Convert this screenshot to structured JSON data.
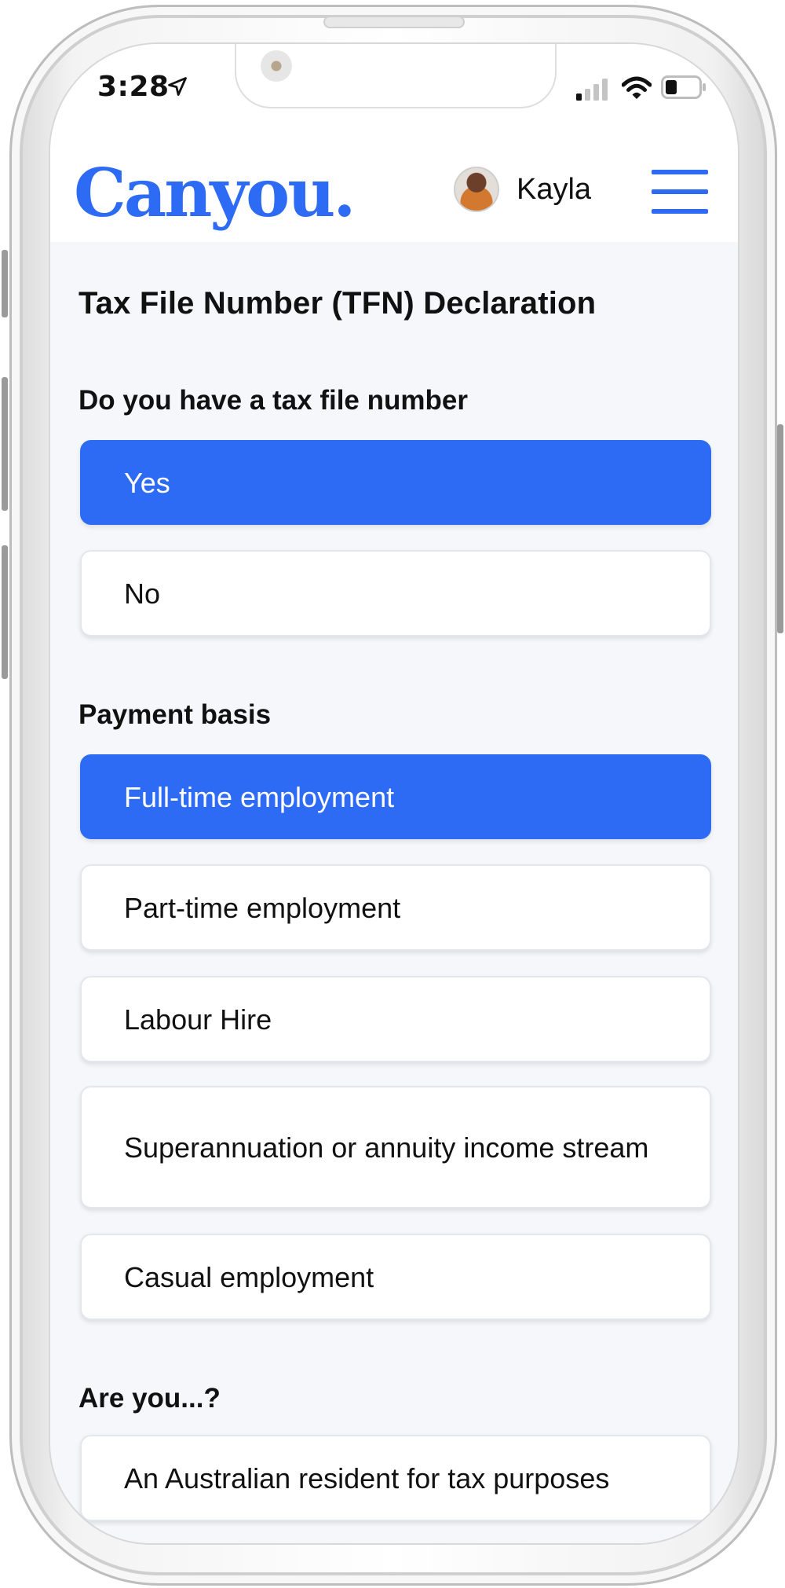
{
  "status_bar": {
    "time": "3:28",
    "icons": [
      "location-arrow-icon",
      "cellular-signal-icon",
      "wifi-icon",
      "battery-icon"
    ]
  },
  "header": {
    "brand": "Canyou.",
    "user_name": "Kayla",
    "menu_icon": "hamburger-menu-icon"
  },
  "form": {
    "title": "Tax File Number (TFN) Declaration",
    "tfn_question": {
      "label": "Do you have a tax file number",
      "options": [
        {
          "label": "Yes",
          "selected": true
        },
        {
          "label": "No",
          "selected": false
        }
      ]
    },
    "payment_basis": {
      "label": "Payment basis",
      "options": [
        {
          "label": "Full-time employment",
          "selected": true
        },
        {
          "label": "Part-time employment",
          "selected": false
        },
        {
          "label": "Labour Hire",
          "selected": false
        },
        {
          "label": "Superannuation or annuity income stream",
          "selected": false
        },
        {
          "label": "Casual employment",
          "selected": false
        }
      ]
    },
    "residency": {
      "label": "Are you...?",
      "options": [
        {
          "label": "An Australian resident for tax purposes",
          "selected": false
        }
      ]
    }
  },
  "colors": {
    "accent": "#2e6bf5",
    "background": "#f5f7fb",
    "text": "#111111"
  }
}
